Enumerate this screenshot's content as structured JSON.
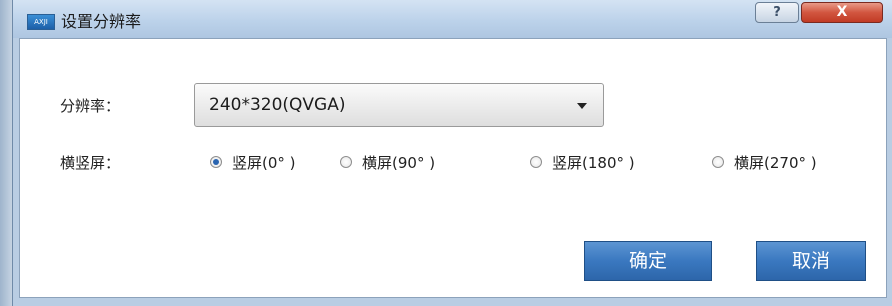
{
  "window": {
    "title": "设置分辨率",
    "icon_text": "AXJI",
    "help_button": "?",
    "close_button": "X"
  },
  "form": {
    "resolution_label": "分辨率：",
    "resolution_value": "240*320(QVGA)",
    "orientation_label": "横竖屏：",
    "orientation_options": [
      {
        "label": "竖屏(0° )",
        "selected": true
      },
      {
        "label": "横屏(90° )",
        "selected": false
      },
      {
        "label": "竖屏(180° )",
        "selected": false
      },
      {
        "label": "横屏(270° )",
        "selected": false
      }
    ]
  },
  "buttons": {
    "ok": "确定",
    "cancel": "取消"
  },
  "colors": {
    "titlebar": "#bcd2ea",
    "button_blue": "#3a78c0",
    "close_red": "#c13b25"
  }
}
